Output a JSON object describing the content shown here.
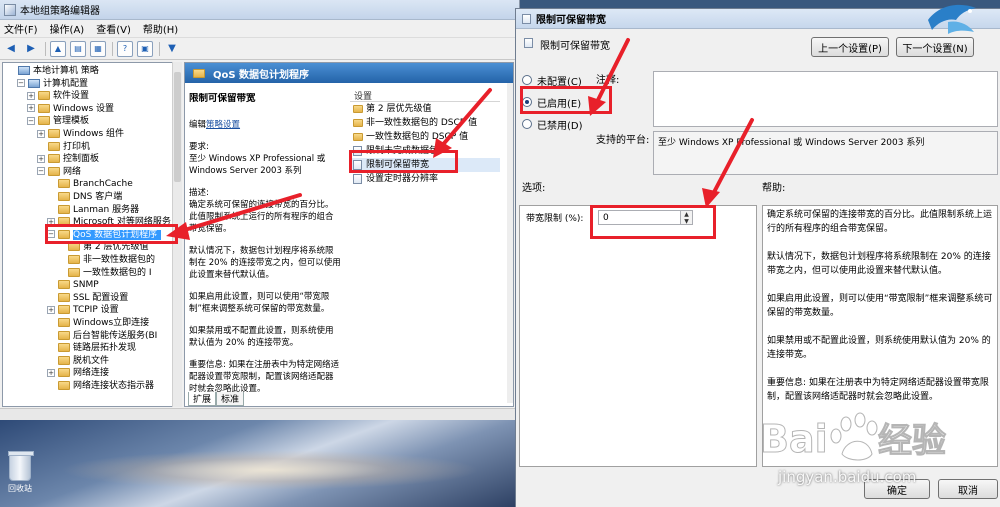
{
  "left_window": {
    "title": "本地组策略编辑器",
    "menu": [
      "文件(F)",
      "操作(A)",
      "查看(V)",
      "帮助(H)"
    ],
    "tree": [
      {
        "label": "本地计算机 策略",
        "level": 0,
        "toggle": "",
        "icon": "pc-icon"
      },
      {
        "label": "计算机配置",
        "level": 1,
        "toggle": "−",
        "icon": "pc-icon"
      },
      {
        "label": "软件设置",
        "level": 2,
        "toggle": "+",
        "icon": "folder-icon"
      },
      {
        "label": "Windows 设置",
        "level": 2,
        "toggle": "+",
        "icon": "folder-icon"
      },
      {
        "label": "管理模板",
        "level": 2,
        "toggle": "−",
        "icon": "folder-icon"
      },
      {
        "label": "Windows 组件",
        "level": 3,
        "toggle": "+",
        "icon": "folder-icon"
      },
      {
        "label": "打印机",
        "level": 3,
        "toggle": "",
        "icon": "folder-icon"
      },
      {
        "label": "控制面板",
        "level": 3,
        "toggle": "+",
        "icon": "folder-icon"
      },
      {
        "label": "网络",
        "level": 3,
        "toggle": "−",
        "icon": "folder-icon"
      },
      {
        "label": "BranchCache",
        "level": 4,
        "toggle": "",
        "icon": "folder-icon"
      },
      {
        "label": "DNS 客户端",
        "level": 4,
        "toggle": "",
        "icon": "folder-icon"
      },
      {
        "label": "Lanman 服务器",
        "level": 4,
        "toggle": "",
        "icon": "folder-icon"
      },
      {
        "label": "Microsoft 对等网络服务",
        "level": 4,
        "toggle": "+",
        "icon": "folder-icon"
      },
      {
        "label": "QoS 数据包计划程序",
        "level": 4,
        "toggle": "−",
        "icon": "folder-icon",
        "selected": true
      },
      {
        "label": "第 2 层优先级值",
        "level": 5,
        "toggle": "",
        "icon": "folder-icon"
      },
      {
        "label": "非一致性数据包的",
        "level": 5,
        "toggle": "",
        "icon": "folder-icon"
      },
      {
        "label": "一致性数据包的 I",
        "level": 5,
        "toggle": "",
        "icon": "folder-icon"
      },
      {
        "label": "SNMP",
        "level": 4,
        "toggle": "",
        "icon": "folder-icon"
      },
      {
        "label": "SSL 配置设置",
        "level": 4,
        "toggle": "",
        "icon": "folder-icon"
      },
      {
        "label": "TCPIP 设置",
        "level": 4,
        "toggle": "+",
        "icon": "folder-icon"
      },
      {
        "label": "Windows立即连接",
        "level": 4,
        "toggle": "",
        "icon": "folder-icon"
      },
      {
        "label": "后台智能传送服务(BI",
        "level": 4,
        "toggle": "",
        "icon": "folder-icon"
      },
      {
        "label": "链路层拓扑发现",
        "level": 4,
        "toggle": "",
        "icon": "folder-icon"
      },
      {
        "label": "脱机文件",
        "level": 4,
        "toggle": "",
        "icon": "folder-icon"
      },
      {
        "label": "网络连接",
        "level": 4,
        "toggle": "+",
        "icon": "folder-icon"
      },
      {
        "label": "网络连接状态指示器",
        "level": 4,
        "toggle": "",
        "icon": "folder-icon"
      }
    ],
    "pane_header": "QoS 数据包计划程序",
    "desc": {
      "heading": "限制可保留带宽",
      "edit_prefix": "编辑",
      "edit_link": "策略设置",
      "req_label": "要求:",
      "req_text": "至少 Windows XP Professional 或 Windows Server 2003 系列",
      "desc_label": "描述:",
      "desc_text": "确定系统可保留的连接带宽的百分比。此值限制系统上运行的所有程序的组合带宽保留。",
      "para2": "默认情况下，数据包计划程序将系统限制在 20% 的连接带宽之内，但可以使用此设置来替代默认值。",
      "para3": "如果启用此设置，则可以使用“带宽限制”框来调整系统可保留的带宽数量。",
      "para4": "如果禁用或不配置此设置，则系统使用默认值为 20% 的连接带宽。",
      "para5": "重要信息: 如果在注册表中为特定网络适配器设置带宽限制，配置该网络适配器时就会忽略此设置。"
    },
    "list_header": "设置",
    "list_items": [
      {
        "label": "第 2 层优先级值",
        "icon": "folder-icon"
      },
      {
        "label": "非一致性数据包的 DSCP 值",
        "icon": "folder-icon"
      },
      {
        "label": "一致性数据包的 DSCP 值",
        "icon": "folder-icon"
      },
      {
        "label": "限制未完成数据包",
        "icon": "policy-icon"
      },
      {
        "label": "限制可保留带宽",
        "icon": "policy-icon",
        "selected": true
      },
      {
        "label": "设置定时器分辨率",
        "icon": "policy-icon"
      }
    ],
    "tabs": [
      "扩展",
      "标准"
    ]
  },
  "desktop": {
    "recycle_label": "回收站"
  },
  "dialog": {
    "title": "限制可保留带宽",
    "setting_name": "限制可保留带宽",
    "prev_button": "上一个设置(P)",
    "next_button": "下一个设置(N)",
    "radio_not_configured": "未配置(C)",
    "radio_enabled": "已启用(E)",
    "radio_disabled": "已禁用(D)",
    "comment_label": "注释:",
    "platform_label": "支持的平台:",
    "platform_text": "至少 Windows XP Professional 或 Windows Server 2003 系列",
    "options_label": "选项:",
    "help_label": "帮助:",
    "bandwidth_label": "带宽限制 (%):",
    "bandwidth_value": "0",
    "help_p1": "确定系统可保留的连接带宽的百分比。此值限制系统上运行的所有程序的组合带宽保留。",
    "help_p2": "默认情况下，数据包计划程序将系统限制在 20% 的连接带宽之内，但可以使用此设置来替代默认值。",
    "help_p3": "如果启用此设置，则可以使用“带宽限制”框来调整系统可保留的带宽数量。",
    "help_p4": "如果禁用或不配置此设置，则系统使用默认值为 20% 的连接带宽。",
    "help_p5": "重要信息: 如果在注册表中为特定网络适配器设置带宽限制，配置该网络适配器时就会忽略此设置。",
    "ok_button": "确定",
    "cancel_button": "取消"
  },
  "watermark": {
    "text": "jingyan.baidu.com"
  },
  "colors": {
    "annotation_red": "#e8202a",
    "selection_blue": "#3399ff",
    "header_blue": "#2463a8"
  }
}
